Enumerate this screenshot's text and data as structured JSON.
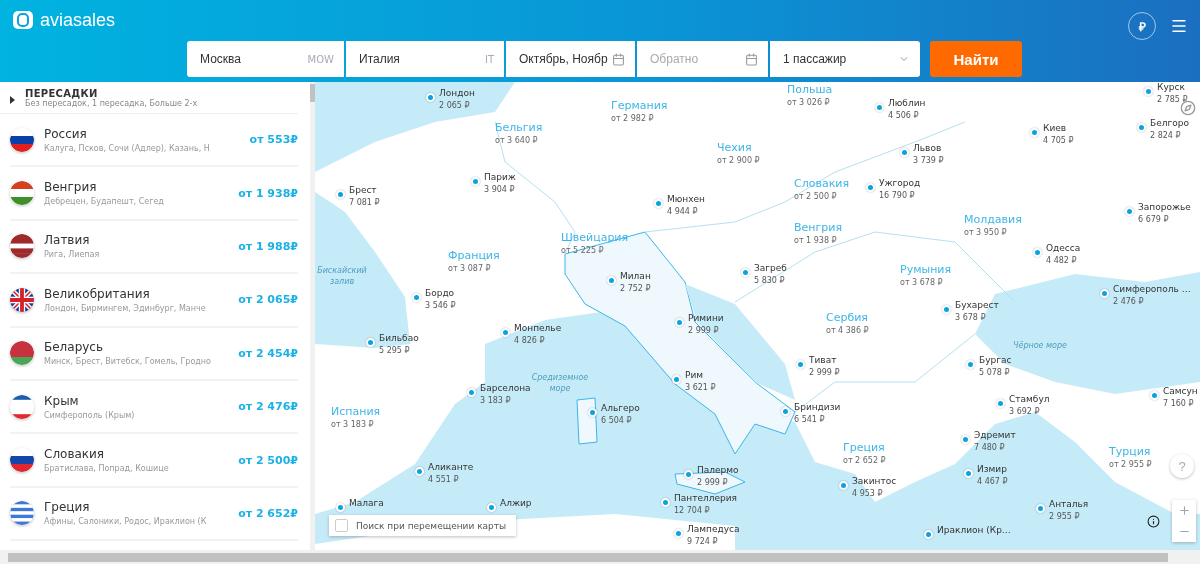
{
  "header": {
    "logo": "aviasales",
    "currency": "₽"
  },
  "search": {
    "origin": {
      "value": "Москва",
      "code": "MOW"
    },
    "destination": {
      "value": "Италия",
      "code": "IT"
    },
    "depart": {
      "value": "Октябрь, Ноябр"
    },
    "return": {
      "placeholder": "Обратно"
    },
    "passengers": "1 пассажир",
    "button": "Найти"
  },
  "filters": {
    "title": "ПЕРЕСАДКИ",
    "summary": "Без пересадок, 1 пересадка, Больше 2-х",
    "expanded": false
  },
  "countries": [
    {
      "name": "Россия",
      "cities": "Калуга, Псков, Сочи (Адлер), Казань, Н",
      "price": "от 553₽"
    },
    {
      "name": "Венгрия",
      "cities": "Дебрецен, Будапешт, Сегед",
      "price": "от 1 938₽"
    },
    {
      "name": "Латвия",
      "cities": "Рига, Лиепая",
      "price": "от 1 988₽"
    },
    {
      "name": "Великобритания",
      "cities": "Лондон, Бирмингем, Эдинбург, Манче",
      "price": "от 2 065₽"
    },
    {
      "name": "Беларусь",
      "cities": "Минск, Брест, Витебск, Гомель, Гродно",
      "price": "от 2 454₽"
    },
    {
      "name": "Крым",
      "cities": "Симферополь (Крым)",
      "price": "от 2 476₽"
    },
    {
      "name": "Словакия",
      "cities": "Братислава, Попрад, Кошице",
      "price": "от 2 500₽"
    },
    {
      "name": "Греция",
      "cities": "Афины, Салоники, Родос, Ираклион (К",
      "price": "от 2 652₽"
    }
  ],
  "map": {
    "countries": [
      {
        "name": "Польша",
        "price": "от 3 026 ₽"
      },
      {
        "name": "Германия",
        "price": "от 2 982 ₽"
      },
      {
        "name": "Бельгия",
        "price": "от 3 640 ₽"
      },
      {
        "name": "Чехия",
        "price": "от 2 900 ₽"
      },
      {
        "name": "Словакия",
        "price": "от 2 500 ₽"
      },
      {
        "name": "Швейцария",
        "price": "от 5 225 ₽"
      },
      {
        "name": "Франция",
        "price": "от 3 087 ₽"
      },
      {
        "name": "Венгрия",
        "price": "от 1 938 ₽"
      },
      {
        "name": "Молдавия",
        "price": "от 3 950 ₽"
      },
      {
        "name": "Румыния",
        "price": "от 3 678 ₽"
      },
      {
        "name": "Сербия",
        "price": "от 4 386 ₽"
      },
      {
        "name": "Испания",
        "price": "от 3 183 ₽"
      },
      {
        "name": "Греция",
        "price": "от 2 652 ₽"
      },
      {
        "name": "Турция",
        "price": "от 2 955 ₽"
      }
    ],
    "cities": [
      {
        "name": "Лондон",
        "price": "2 065 ₽"
      },
      {
        "name": "Париж",
        "price": "3 904 ₽"
      },
      {
        "name": "Брест",
        "price": "7 081 ₽"
      },
      {
        "name": "Мюнхен",
        "price": "4 944 ₽"
      },
      {
        "name": "Милан",
        "price": "2 752 ₽"
      },
      {
        "name": "Бордо",
        "price": "3 546 ₽"
      },
      {
        "name": "Римини",
        "price": "2 999 ₽"
      },
      {
        "name": "Бильбао",
        "price": "5 295 ₽"
      },
      {
        "name": "Монпелье",
        "price": "4 826 ₽"
      },
      {
        "name": "Барселона",
        "price": "3 183 ₽"
      },
      {
        "name": "Рим",
        "price": "3 621 ₽"
      },
      {
        "name": "Альгеро",
        "price": "6 504 ₽"
      },
      {
        "name": "Аликанте",
        "price": "4 551 ₽"
      },
      {
        "name": "Палермо",
        "price": "2 999 ₽"
      },
      {
        "name": "Малага"
      },
      {
        "name": "Алжир"
      },
      {
        "name": "Пантеллерия",
        "price": "12 704 ₽"
      },
      {
        "name": "Лампедуса",
        "price": "9 724 ₽"
      },
      {
        "name": "Люблин",
        "price": "4 506 ₽"
      },
      {
        "name": "Львов",
        "price": "3 739 ₽"
      },
      {
        "name": "Киев",
        "price": "4 705 ₽"
      },
      {
        "name": "Курск",
        "price": "2 785 ₽"
      },
      {
        "name": "Белгоро",
        "price": "2 824 ₽"
      },
      {
        "name": "Ужгород",
        "price": "16 790 ₽"
      },
      {
        "name": "Запорожье",
        "price": "6 679 ₽"
      },
      {
        "name": "Загреб",
        "price": "5 830 ₽"
      },
      {
        "name": "Одесса",
        "price": "4 482 ₽"
      },
      {
        "name": "Симферополь …",
        "price": "2 476 ₽"
      },
      {
        "name": "Бухарест",
        "price": "3 678 ₽"
      },
      {
        "name": "Тиват",
        "price": "2 999 ₽"
      },
      {
        "name": "Бургас",
        "price": "5 078 ₽"
      },
      {
        "name": "Стамбул",
        "price": "3 692 ₽"
      },
      {
        "name": "Самсун",
        "price": "7 160 ₽"
      },
      {
        "name": "Бриндизи",
        "price": "6 541 ₽"
      },
      {
        "name": "Эдремит",
        "price": "7 480 ₽"
      },
      {
        "name": "Закинтос",
        "price": "4 953 ₽"
      },
      {
        "name": "Измир",
        "price": "4 467 ₽"
      },
      {
        "name": "Анталья",
        "price": "2 955 ₽"
      },
      {
        "name": "Ираклион (Кр…"
      }
    ],
    "seas": [
      "Бискайский залив",
      "Средиземное море",
      "Чёрное море"
    ],
    "search_on_move": {
      "label": "Поиск при перемещении карты",
      "checked": false
    },
    "help": "?"
  }
}
